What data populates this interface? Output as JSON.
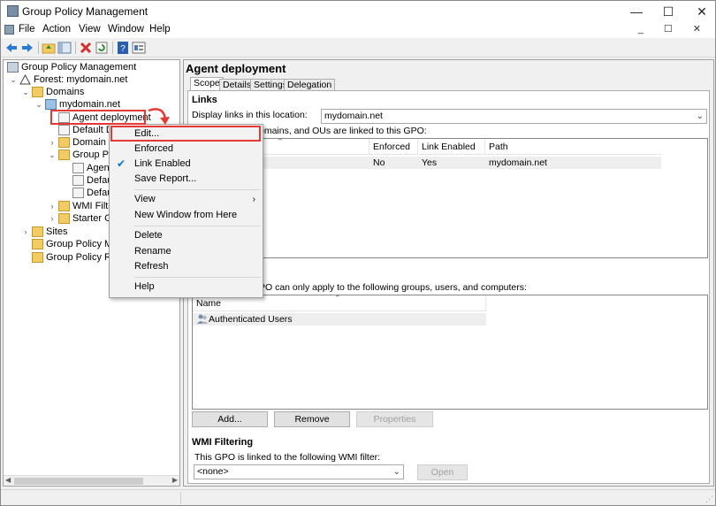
{
  "window": {
    "title": "Group Policy Management",
    "min_glyph": "—",
    "max_glyph": "☐",
    "close_glyph": "✕",
    "mdi_controls": "_ ☐ ✕"
  },
  "menubar": [
    "File",
    "Action",
    "View",
    "Window",
    "Help"
  ],
  "toolbar_icons": [
    "back-icon",
    "forward-icon",
    "up-folder-icon",
    "show-tree-icon",
    "delete-icon",
    "refresh-icon",
    "help-icon",
    "properties-icon"
  ],
  "tree": {
    "root": "Group Policy Management",
    "forest": "Forest: mydomain.net",
    "domains": "Domains",
    "domain": "mydomain.net",
    "agent_deployment": "Agent deployment",
    "default_dc": "Default Dc",
    "domain_c": "Domain C",
    "group_pol": "Group Pol",
    "agent": "Agent",
    "defaul1": "Defaul",
    "defaul2": "Defaul",
    "wmi_filter": "WMI Filter",
    "starter_gp": "Starter GP",
    "sites": "Sites",
    "gp_mod": "Group Policy Mod",
    "gp_res": "Group Policy Res"
  },
  "detail": {
    "title": "Agent deployment",
    "tabs": [
      "Scope",
      "Details",
      "Settings",
      "Delegation"
    ],
    "links_heading": "Links",
    "display_links_label": "Display links in this location:",
    "location_value": "mydomain.net",
    "linked_text": "omains, and OUs are linked to this GPO:",
    "links_columns": [
      "Enforced",
      "Link Enabled",
      "Path"
    ],
    "links_rows": [
      {
        "enforced": "No",
        "link_enabled": "Yes",
        "path": "mydomain.net"
      }
    ],
    "security_text": "PO can only apply to the following groups, users, and computers:",
    "security_column": "Name",
    "security_rows": [
      "Authenticated Users"
    ],
    "buttons": {
      "add": "Add...",
      "remove": "Remove",
      "properties": "Properties"
    },
    "wmi_heading": "WMI Filtering",
    "wmi_label": "This GPO is linked to the following WMI filter:",
    "wmi_value": "<none>",
    "open_button": "Open"
  },
  "context_menu": {
    "items": [
      {
        "label": "Edit...",
        "checked": false
      },
      {
        "label": "Enforced",
        "checked": false
      },
      {
        "label": "Link Enabled",
        "checked": true
      },
      {
        "label": "Save Report...",
        "checked": false
      },
      {
        "label": "View",
        "submenu": true
      },
      {
        "label": "New Window from Here"
      },
      {
        "label": "Delete"
      },
      {
        "label": "Rename"
      },
      {
        "label": "Refresh"
      },
      {
        "label": "Help"
      }
    ],
    "check_glyph": "✔",
    "submenu_glyph": "›"
  },
  "colors": {
    "highlight_red": "#e53935",
    "check_blue": "#0078d7"
  }
}
